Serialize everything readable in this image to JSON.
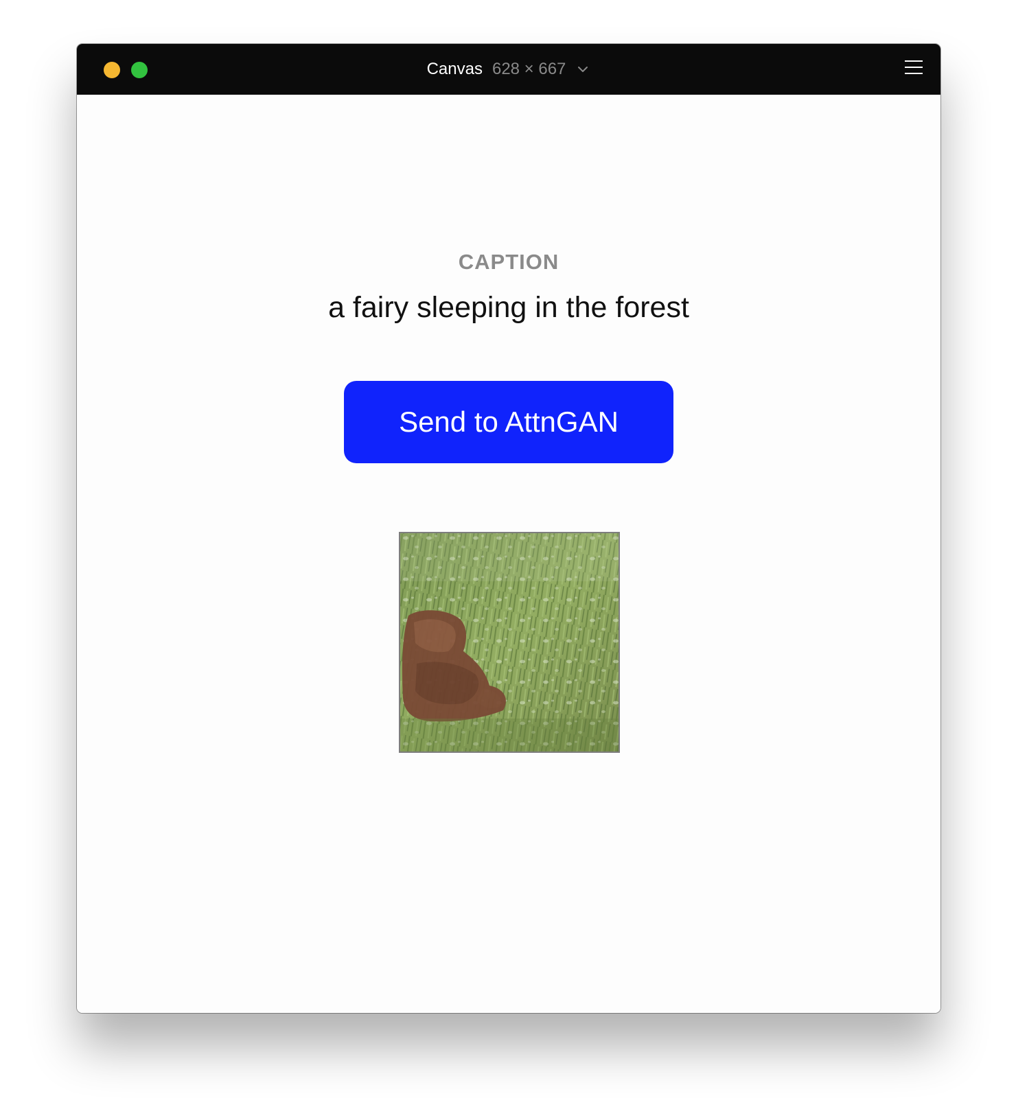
{
  "window": {
    "title": "Canvas",
    "size_label": "628 × 667",
    "dropdown_icon": "chevron-down-icon",
    "menu_icon": "hamburger-menu-icon",
    "traffic_lights": {
      "minimize_color": "#f5b731",
      "maximize_color": "#32c23f"
    }
  },
  "main": {
    "caption_heading": "CAPTION",
    "caption_text": "a fairy sleeping in the forest",
    "send_button_label": "Send to AttnGAN",
    "send_button_color": "#1023fc",
    "generated_image_alt": "AttnGAN generated image"
  }
}
